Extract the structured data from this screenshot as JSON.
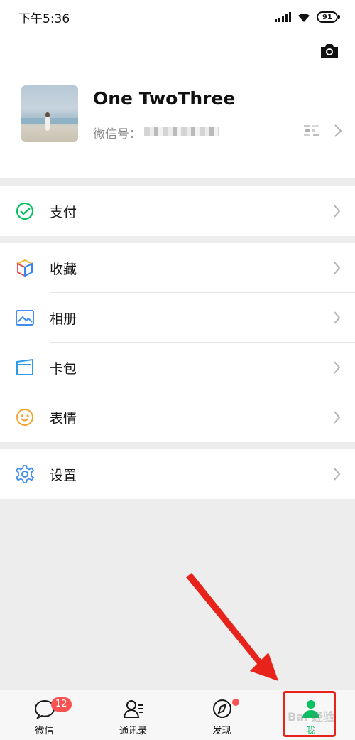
{
  "status_bar": {
    "time": "下午5:36",
    "battery": "91"
  },
  "profile": {
    "name": "One TwoThree",
    "wechat_id_label": "微信号："
  },
  "menu": {
    "pay": {
      "label": "支付",
      "icon": "pay-check-icon"
    },
    "favorites": {
      "label": "收藏",
      "icon": "cube-icon"
    },
    "album": {
      "label": "相册",
      "icon": "picture-icon"
    },
    "cards": {
      "label": "卡包",
      "icon": "card-wallet-icon"
    },
    "stickers": {
      "label": "表情",
      "icon": "smiley-icon"
    },
    "settings": {
      "label": "设置",
      "icon": "gear-icon"
    }
  },
  "tab_bar": {
    "chats": {
      "label": "微信",
      "badge": "12"
    },
    "contacts": {
      "label": "通讯录"
    },
    "discover": {
      "label": "发现"
    },
    "me": {
      "label": "我"
    }
  },
  "colors": {
    "accent_green": "#07c160",
    "badge_red": "#fa5151",
    "annotation_red": "#e8231c",
    "page_bg": "#ededed"
  },
  "watermark": "Bai 经验"
}
